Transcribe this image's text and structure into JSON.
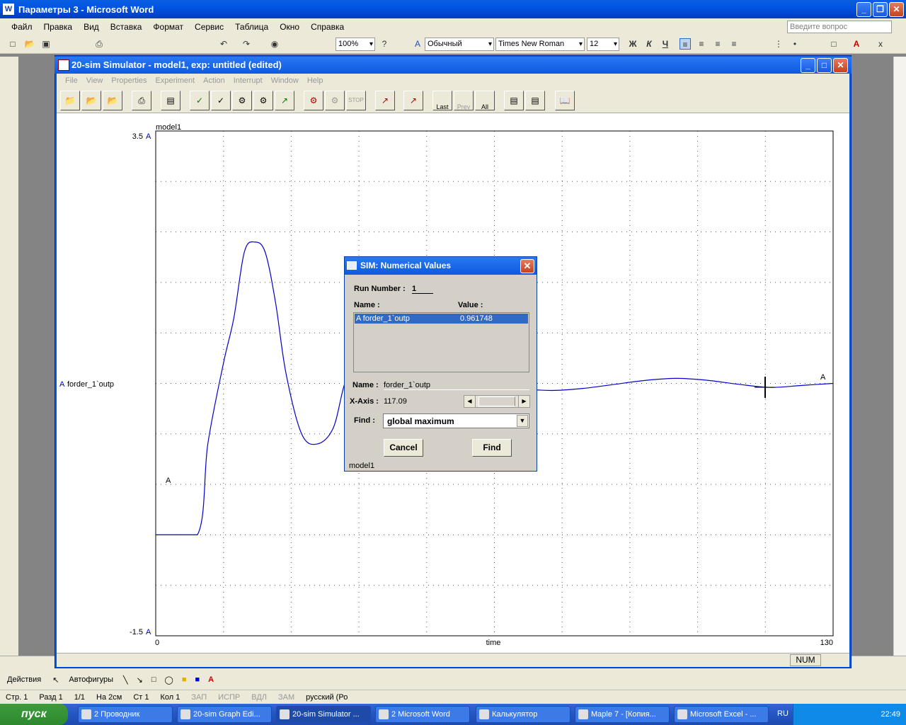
{
  "word": {
    "title": "Параметры 3 - Microsoft Word",
    "menu": [
      "Файл",
      "Правка",
      "Вид",
      "Вставка",
      "Формат",
      "Сервис",
      "Таблица",
      "Окно",
      "Справка"
    ],
    "help_placeholder": "Введите вопрос",
    "zoom": "100%",
    "style": "Обычный",
    "font": "Times New Roman",
    "size": "12",
    "bold": "Ж",
    "italic": "К",
    "underline": "Ч",
    "status": {
      "page": "Стр. 1",
      "section": "Разд 1",
      "pages": "1/1",
      "at": "На 2см",
      "line": "Ст 1",
      "col": "Кол 1",
      "rec": "ЗАП",
      "trk": "ИСПР",
      "ext": "ВДЛ",
      "ovr": "ЗАМ",
      "lang": "русский (Ро"
    },
    "draw": {
      "actions": "Действия",
      "autoshapes": "Автофигуры"
    }
  },
  "sim": {
    "title": "20-sim  Simulator - model1, exp: untitled (edited)",
    "menu": [
      "File",
      "View",
      "Properties",
      "Experiment",
      "Action",
      "Interrupt",
      "Window",
      "Help"
    ],
    "tb_last": "Last",
    "tb_prev": "Prev",
    "tb_all": "All",
    "status_num": "NUM",
    "plot": {
      "caption": "model1",
      "y_top": "3.5",
      "y_bottom": "-1.5",
      "x_left": "0",
      "x_right": "130",
      "xlabel": "time",
      "series_tag": "A",
      "series_name": "forder_1`outp",
      "line_color": "#0000cc"
    }
  },
  "chart_data": {
    "type": "line",
    "title": "model1",
    "xlabel": "time",
    "ylabel": "",
    "xlim": [
      0,
      130
    ],
    "ylim": [
      -1.5,
      3.5
    ],
    "series": [
      {
        "name": "A forder_1`outp",
        "x": [
          0,
          8,
          10,
          13,
          15,
          17,
          19,
          21,
          23,
          25,
          28,
          31,
          34,
          36,
          38,
          40,
          44,
          48,
          52,
          56,
          60,
          64,
          70,
          76,
          82,
          88,
          94,
          100,
          106,
          112,
          118,
          124,
          130
        ],
        "y": [
          -0.5,
          -0.5,
          0.4,
          1.2,
          1.65,
          2.3,
          2.4,
          2.3,
          1.8,
          1.1,
          0.5,
          0.4,
          0.55,
          0.95,
          1.3,
          1.45,
          1.53,
          1.45,
          1.3,
          1.18,
          1.06,
          1.0,
          0.95,
          0.93,
          0.95,
          0.99,
          1.03,
          1.05,
          1.03,
          0.99,
          0.96,
          0.98,
          1.0
        ]
      }
    ]
  },
  "dialog": {
    "title": "SIM: Numerical Values",
    "run_label": "Run Number :",
    "run_value": "1",
    "name_header": "Name :",
    "value_header": "Value :",
    "row_name": "A forder_1`outp",
    "row_value": "0.961748",
    "name_label": "Name :",
    "name_value": "forder_1`outp",
    "xaxis_label": "X-Axis :",
    "xaxis_value": "117.09",
    "find_label": "Find :",
    "find_value": "global maximum",
    "cancel": "Cancel",
    "find_button": "Find",
    "footer": "model1"
  },
  "taskbar": {
    "start": "пуск",
    "items": [
      "2 Проводник",
      "20-sim  Graph Edi...",
      "20-sim  Simulator ...",
      "2 Microsoft Word",
      "Калькулятор",
      "Maple 7 - [Копия...",
      "Microsoft Excel - ..."
    ],
    "lang": "RU",
    "clock": "22:49"
  }
}
